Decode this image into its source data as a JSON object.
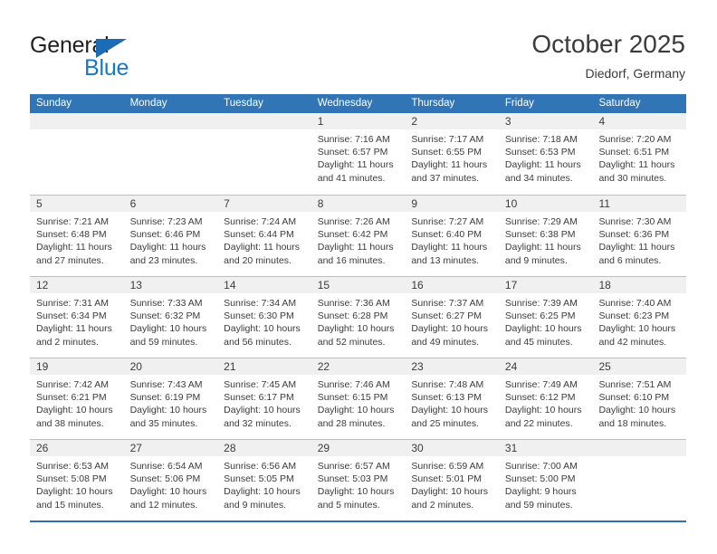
{
  "brand": {
    "name_top": "General",
    "name_bottom": "Blue",
    "triangle_color": "#1b6cb5",
    "text_color": "#231f20",
    "blue_color": "#1878c8"
  },
  "header": {
    "title": "October 2025",
    "subtitle": "Diedorf, Germany"
  },
  "theme": {
    "header_row_bg": "#3175b6",
    "header_row_text": "#ffffff",
    "day_band_bg": "#f0f0f0",
    "grid_line": "#bfbfbf",
    "bottom_rule": "#2f6fae"
  },
  "weekdays": [
    "Sunday",
    "Monday",
    "Tuesday",
    "Wednesday",
    "Thursday",
    "Friday",
    "Saturday"
  ],
  "weeks": [
    [
      {
        "day": "",
        "sunrise": "",
        "sunset": "",
        "daylight_line1": "",
        "daylight_line2": "",
        "empty": true
      },
      {
        "day": "",
        "sunrise": "",
        "sunset": "",
        "daylight_line1": "",
        "daylight_line2": "",
        "empty": true
      },
      {
        "day": "",
        "sunrise": "",
        "sunset": "",
        "daylight_line1": "",
        "daylight_line2": "",
        "empty": true
      },
      {
        "day": "1",
        "sunrise": "Sunrise: 7:16 AM",
        "sunset": "Sunset: 6:57 PM",
        "daylight_line1": "Daylight: 11 hours",
        "daylight_line2": "and 41 minutes.",
        "empty": false
      },
      {
        "day": "2",
        "sunrise": "Sunrise: 7:17 AM",
        "sunset": "Sunset: 6:55 PM",
        "daylight_line1": "Daylight: 11 hours",
        "daylight_line2": "and 37 minutes.",
        "empty": false
      },
      {
        "day": "3",
        "sunrise": "Sunrise: 7:18 AM",
        "sunset": "Sunset: 6:53 PM",
        "daylight_line1": "Daylight: 11 hours",
        "daylight_line2": "and 34 minutes.",
        "empty": false
      },
      {
        "day": "4",
        "sunrise": "Sunrise: 7:20 AM",
        "sunset": "Sunset: 6:51 PM",
        "daylight_line1": "Daylight: 11 hours",
        "daylight_line2": "and 30 minutes.",
        "empty": false
      }
    ],
    [
      {
        "day": "5",
        "sunrise": "Sunrise: 7:21 AM",
        "sunset": "Sunset: 6:48 PM",
        "daylight_line1": "Daylight: 11 hours",
        "daylight_line2": "and 27 minutes.",
        "empty": false
      },
      {
        "day": "6",
        "sunrise": "Sunrise: 7:23 AM",
        "sunset": "Sunset: 6:46 PM",
        "daylight_line1": "Daylight: 11 hours",
        "daylight_line2": "and 23 minutes.",
        "empty": false
      },
      {
        "day": "7",
        "sunrise": "Sunrise: 7:24 AM",
        "sunset": "Sunset: 6:44 PM",
        "daylight_line1": "Daylight: 11 hours",
        "daylight_line2": "and 20 minutes.",
        "empty": false
      },
      {
        "day": "8",
        "sunrise": "Sunrise: 7:26 AM",
        "sunset": "Sunset: 6:42 PM",
        "daylight_line1": "Daylight: 11 hours",
        "daylight_line2": "and 16 minutes.",
        "empty": false
      },
      {
        "day": "9",
        "sunrise": "Sunrise: 7:27 AM",
        "sunset": "Sunset: 6:40 PM",
        "daylight_line1": "Daylight: 11 hours",
        "daylight_line2": "and 13 minutes.",
        "empty": false
      },
      {
        "day": "10",
        "sunrise": "Sunrise: 7:29 AM",
        "sunset": "Sunset: 6:38 PM",
        "daylight_line1": "Daylight: 11 hours",
        "daylight_line2": "and 9 minutes.",
        "empty": false
      },
      {
        "day": "11",
        "sunrise": "Sunrise: 7:30 AM",
        "sunset": "Sunset: 6:36 PM",
        "daylight_line1": "Daylight: 11 hours",
        "daylight_line2": "and 6 minutes.",
        "empty": false
      }
    ],
    [
      {
        "day": "12",
        "sunrise": "Sunrise: 7:31 AM",
        "sunset": "Sunset: 6:34 PM",
        "daylight_line1": "Daylight: 11 hours",
        "daylight_line2": "and 2 minutes.",
        "empty": false
      },
      {
        "day": "13",
        "sunrise": "Sunrise: 7:33 AM",
        "sunset": "Sunset: 6:32 PM",
        "daylight_line1": "Daylight: 10 hours",
        "daylight_line2": "and 59 minutes.",
        "empty": false
      },
      {
        "day": "14",
        "sunrise": "Sunrise: 7:34 AM",
        "sunset": "Sunset: 6:30 PM",
        "daylight_line1": "Daylight: 10 hours",
        "daylight_line2": "and 56 minutes.",
        "empty": false
      },
      {
        "day": "15",
        "sunrise": "Sunrise: 7:36 AM",
        "sunset": "Sunset: 6:28 PM",
        "daylight_line1": "Daylight: 10 hours",
        "daylight_line2": "and 52 minutes.",
        "empty": false
      },
      {
        "day": "16",
        "sunrise": "Sunrise: 7:37 AM",
        "sunset": "Sunset: 6:27 PM",
        "daylight_line1": "Daylight: 10 hours",
        "daylight_line2": "and 49 minutes.",
        "empty": false
      },
      {
        "day": "17",
        "sunrise": "Sunrise: 7:39 AM",
        "sunset": "Sunset: 6:25 PM",
        "daylight_line1": "Daylight: 10 hours",
        "daylight_line2": "and 45 minutes.",
        "empty": false
      },
      {
        "day": "18",
        "sunrise": "Sunrise: 7:40 AM",
        "sunset": "Sunset: 6:23 PM",
        "daylight_line1": "Daylight: 10 hours",
        "daylight_line2": "and 42 minutes.",
        "empty": false
      }
    ],
    [
      {
        "day": "19",
        "sunrise": "Sunrise: 7:42 AM",
        "sunset": "Sunset: 6:21 PM",
        "daylight_line1": "Daylight: 10 hours",
        "daylight_line2": "and 38 minutes.",
        "empty": false
      },
      {
        "day": "20",
        "sunrise": "Sunrise: 7:43 AM",
        "sunset": "Sunset: 6:19 PM",
        "daylight_line1": "Daylight: 10 hours",
        "daylight_line2": "and 35 minutes.",
        "empty": false
      },
      {
        "day": "21",
        "sunrise": "Sunrise: 7:45 AM",
        "sunset": "Sunset: 6:17 PM",
        "daylight_line1": "Daylight: 10 hours",
        "daylight_line2": "and 32 minutes.",
        "empty": false
      },
      {
        "day": "22",
        "sunrise": "Sunrise: 7:46 AM",
        "sunset": "Sunset: 6:15 PM",
        "daylight_line1": "Daylight: 10 hours",
        "daylight_line2": "and 28 minutes.",
        "empty": false
      },
      {
        "day": "23",
        "sunrise": "Sunrise: 7:48 AM",
        "sunset": "Sunset: 6:13 PM",
        "daylight_line1": "Daylight: 10 hours",
        "daylight_line2": "and 25 minutes.",
        "empty": false
      },
      {
        "day": "24",
        "sunrise": "Sunrise: 7:49 AM",
        "sunset": "Sunset: 6:12 PM",
        "daylight_line1": "Daylight: 10 hours",
        "daylight_line2": "and 22 minutes.",
        "empty": false
      },
      {
        "day": "25",
        "sunrise": "Sunrise: 7:51 AM",
        "sunset": "Sunset: 6:10 PM",
        "daylight_line1": "Daylight: 10 hours",
        "daylight_line2": "and 18 minutes.",
        "empty": false
      }
    ],
    [
      {
        "day": "26",
        "sunrise": "Sunrise: 6:53 AM",
        "sunset": "Sunset: 5:08 PM",
        "daylight_line1": "Daylight: 10 hours",
        "daylight_line2": "and 15 minutes.",
        "empty": false
      },
      {
        "day": "27",
        "sunrise": "Sunrise: 6:54 AM",
        "sunset": "Sunset: 5:06 PM",
        "daylight_line1": "Daylight: 10 hours",
        "daylight_line2": "and 12 minutes.",
        "empty": false
      },
      {
        "day": "28",
        "sunrise": "Sunrise: 6:56 AM",
        "sunset": "Sunset: 5:05 PM",
        "daylight_line1": "Daylight: 10 hours",
        "daylight_line2": "and 9 minutes.",
        "empty": false
      },
      {
        "day": "29",
        "sunrise": "Sunrise: 6:57 AM",
        "sunset": "Sunset: 5:03 PM",
        "daylight_line1": "Daylight: 10 hours",
        "daylight_line2": "and 5 minutes.",
        "empty": false
      },
      {
        "day": "30",
        "sunrise": "Sunrise: 6:59 AM",
        "sunset": "Sunset: 5:01 PM",
        "daylight_line1": "Daylight: 10 hours",
        "daylight_line2": "and 2 minutes.",
        "empty": false
      },
      {
        "day": "31",
        "sunrise": "Sunrise: 7:00 AM",
        "sunset": "Sunset: 5:00 PM",
        "daylight_line1": "Daylight: 9 hours",
        "daylight_line2": "and 59 minutes.",
        "empty": false
      },
      {
        "day": "",
        "sunrise": "",
        "sunset": "",
        "daylight_line1": "",
        "daylight_line2": "",
        "empty": true
      }
    ]
  ]
}
